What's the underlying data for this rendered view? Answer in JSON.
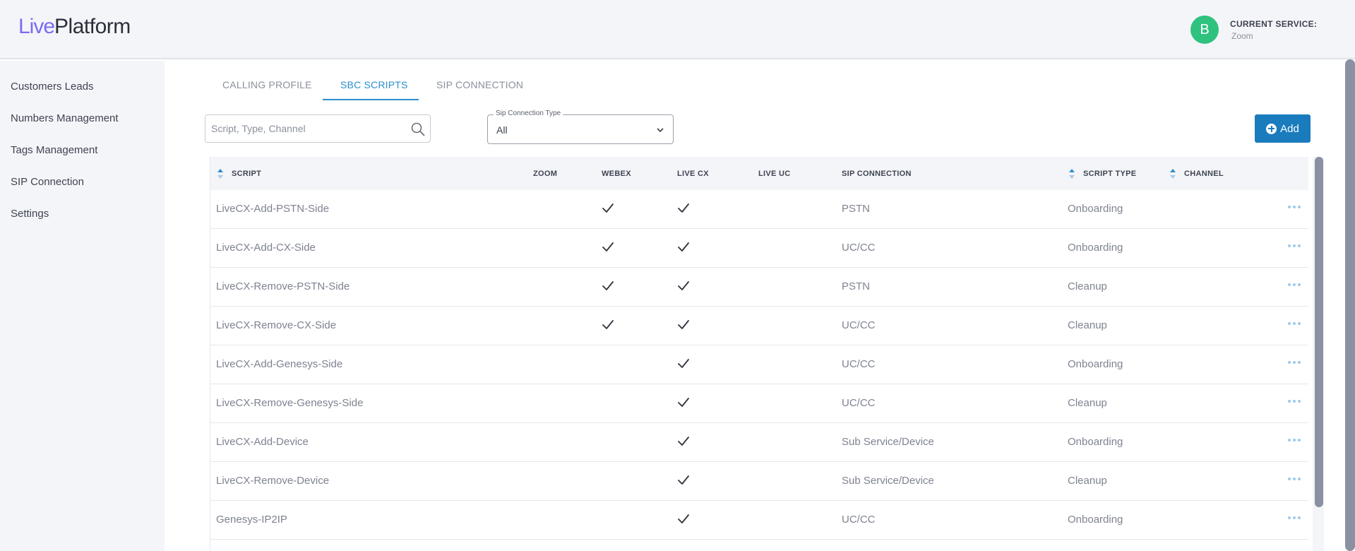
{
  "brand": {
    "live": "Live",
    "platform": "Platform"
  },
  "header": {
    "avatar_letter": "B",
    "service_label": "CURRENT SERVICE:",
    "service_value": "Zoom"
  },
  "sidebar": {
    "items": [
      {
        "label": "Customers Leads"
      },
      {
        "label": "Numbers Management"
      },
      {
        "label": "Tags Management"
      },
      {
        "label": "SIP Connection"
      },
      {
        "label": "Settings"
      }
    ]
  },
  "tabs": [
    {
      "label": "CALLING PROFILE",
      "active": false
    },
    {
      "label": "SBC SCRIPTS",
      "active": true
    },
    {
      "label": "SIP CONNECTION",
      "active": false
    }
  ],
  "search": {
    "placeholder": "Script, Type, Channel"
  },
  "filter": {
    "label": "Sip Connection Type",
    "value": "All"
  },
  "add_button": {
    "label": "Add"
  },
  "table": {
    "columns": {
      "script": "SCRIPT",
      "zoom": "ZOOM",
      "webex": "WEBEX",
      "live_cx": "LIVE CX",
      "live_uc": "LIVE UC",
      "sip_connection": "SIP CONNECTION",
      "script_type": "SCRIPT TYPE",
      "channel": "CHANNEL"
    },
    "rows": [
      {
        "script": "LiveCX-Add-PSTN-Side",
        "zoom": false,
        "webex": true,
        "live_cx": true,
        "live_uc": false,
        "sip_connection": "PSTN",
        "script_type": "Onboarding"
      },
      {
        "script": "LiveCX-Add-CX-Side",
        "zoom": false,
        "webex": true,
        "live_cx": true,
        "live_uc": false,
        "sip_connection": "UC/CC",
        "script_type": "Onboarding"
      },
      {
        "script": "LiveCX-Remove-PSTN-Side",
        "zoom": false,
        "webex": true,
        "live_cx": true,
        "live_uc": false,
        "sip_connection": "PSTN",
        "script_type": "Cleanup"
      },
      {
        "script": "LiveCX-Remove-CX-Side",
        "zoom": false,
        "webex": true,
        "live_cx": true,
        "live_uc": false,
        "sip_connection": "UC/CC",
        "script_type": "Cleanup"
      },
      {
        "script": "LiveCX-Add-Genesys-Side",
        "zoom": false,
        "webex": false,
        "live_cx": true,
        "live_uc": false,
        "sip_connection": "UC/CC",
        "script_type": "Onboarding"
      },
      {
        "script": "LiveCX-Remove-Genesys-Side",
        "zoom": false,
        "webex": false,
        "live_cx": true,
        "live_uc": false,
        "sip_connection": "UC/CC",
        "script_type": "Cleanup"
      },
      {
        "script": "LiveCX-Add-Device",
        "zoom": false,
        "webex": false,
        "live_cx": true,
        "live_uc": false,
        "sip_connection": "Sub Service/Device",
        "script_type": "Onboarding"
      },
      {
        "script": "LiveCX-Remove-Device",
        "zoom": false,
        "webex": false,
        "live_cx": true,
        "live_uc": false,
        "sip_connection": "Sub Service/Device",
        "script_type": "Cleanup"
      },
      {
        "script": "Genesys-IP2IP",
        "zoom": false,
        "webex": false,
        "live_cx": true,
        "live_uc": false,
        "sip_connection": "UC/CC",
        "script_type": "Onboarding"
      }
    ]
  },
  "colors": {
    "accent": "#2b8fcf",
    "add_button": "#1a7bbd",
    "avatar": "#2ec27e",
    "logo_live": "#7a6cf2",
    "more_dots": "#9ccbea"
  },
  "icons": {
    "search": "search-icon",
    "select": "chevron-down-icon",
    "add": "plus-circle-icon",
    "sort": "sort-icon",
    "check": "check-icon",
    "more": "more-horizontal-icon"
  }
}
